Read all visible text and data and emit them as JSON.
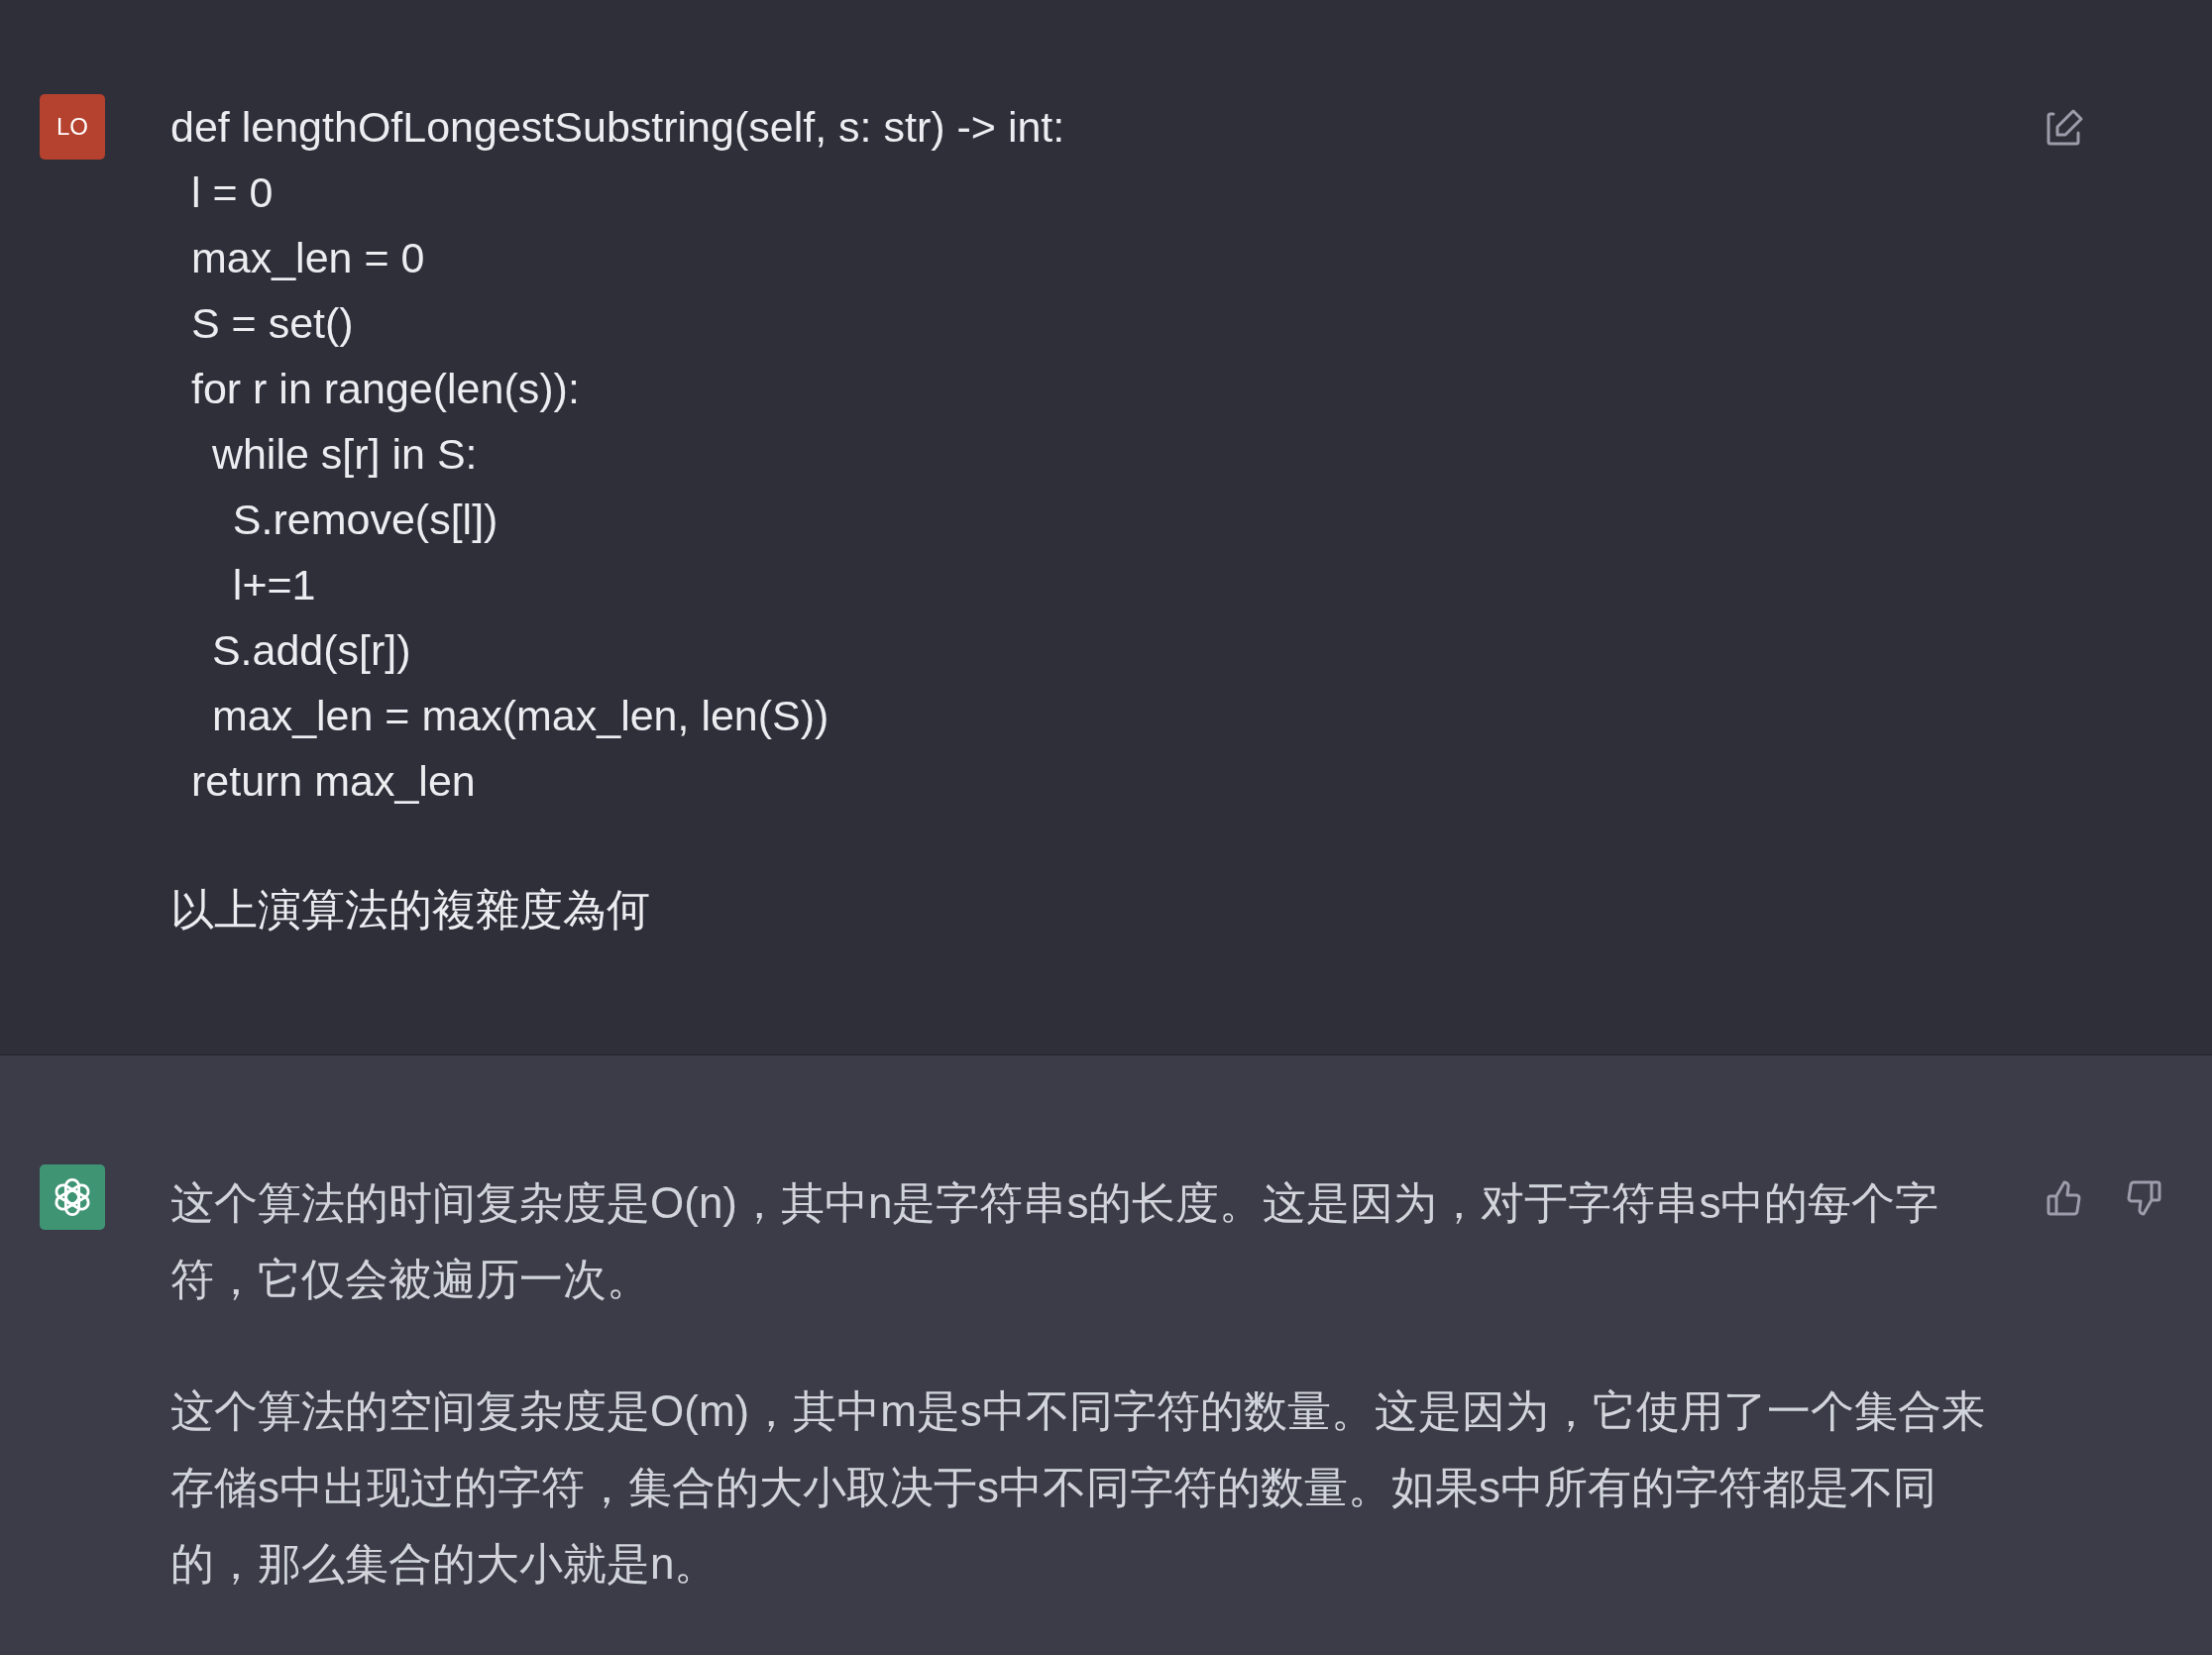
{
  "messages": [
    {
      "kind": "user",
      "avatar": "LO",
      "code_lines": [
        "def lengthOfLongestSubstring(self, s: str) -> int:",
        " l = 0",
        " max_len = 0",
        " S = set()",
        " for r in range(len(s)):",
        "  while s[r] in S:",
        "   S.remove(s[l])",
        "   l+=1",
        "  S.add(s[r])",
        "  max_len = max(max_len, len(S))",
        " return max_len"
      ],
      "paragraphs": [
        "以上演算法的複雜度為何"
      ]
    },
    {
      "kind": "assistant",
      "paragraphs": [
        "这个算法的时间复杂度是O(n)，其中n是字符串s的长度。这是因为，对于字符串s中的每个字符，它仅会被遍历一次。",
        "这个算法的空间复杂度是O(m)，其中m是s中不同字符的数量。这是因为，它使用了一个集合来存储s中出现过的字符，集合的大小取决于s中不同字符的数量。如果s中所有的字符都是不同的，那么集合的大小就是n。"
      ]
    }
  ]
}
